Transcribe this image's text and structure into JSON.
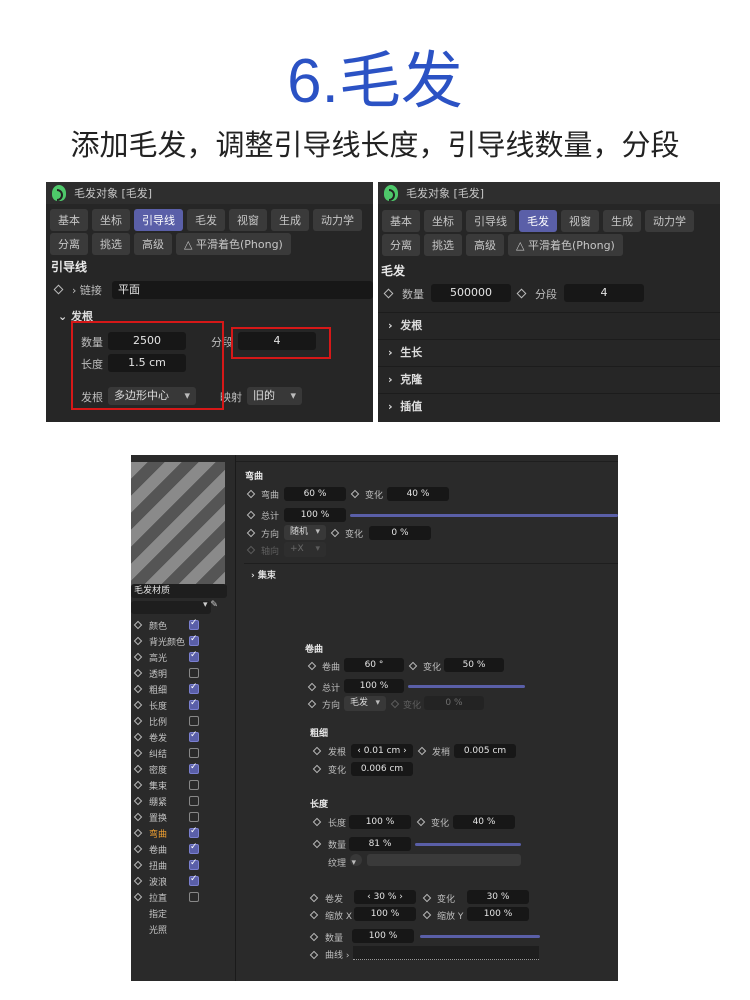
{
  "title": "6.毛发",
  "subtitle": "添加毛发，调整引导线长度，引导线数量，分段",
  "colors": {
    "title": "#2b52c4",
    "accent": "#5a5fa8",
    "highlight_box": "#d61818",
    "panel_bg": "#262626"
  },
  "panel_a": {
    "header": "毛发对象 [毛发]",
    "tabs_row1": [
      "基本",
      "坐标",
      "引导线",
      "毛发",
      "视窗",
      "生成",
      "动力学"
    ],
    "tabs_row2": [
      "分离",
      "挑选",
      "高级",
      "平滑着色(Phong)"
    ],
    "active_tab": "引导线",
    "section": "引导线",
    "link_label": "链接",
    "link_value": "平面",
    "group": "发根",
    "count_label": "数量",
    "count_value": "2500",
    "length_label": "长度",
    "length_value": "1.5 cm",
    "segments_label": "分段",
    "segments_value": "4",
    "root_label": "发根",
    "root_value": "多边形中心",
    "mapping_label": "映射",
    "mapping_value": "旧的"
  },
  "panel_b": {
    "header": "毛发对象 [毛发]",
    "tabs_row1": [
      "基本",
      "坐标",
      "引导线",
      "毛发",
      "视窗",
      "生成",
      "动力学"
    ],
    "tabs_row2": [
      "分离",
      "挑选",
      "高级",
      "平滑着色(Phong)"
    ],
    "active_tab": "毛发",
    "section": "毛发",
    "count_label": "数量",
    "count_value": "500000",
    "segments_label": "分段",
    "segments_value": "4",
    "groups": [
      "发根",
      "生长",
      "克隆",
      "插值"
    ]
  },
  "material": {
    "name": "毛发材质",
    "channels": [
      {
        "label": "颜色",
        "checked": true
      },
      {
        "label": "背光颜色",
        "checked": true
      },
      {
        "label": "高光",
        "checked": true
      },
      {
        "label": "透明",
        "checked": false
      },
      {
        "label": "粗细",
        "checked": true
      },
      {
        "label": "长度",
        "checked": true
      },
      {
        "label": "比例",
        "checked": false
      },
      {
        "label": "卷发",
        "checked": true
      },
      {
        "label": "纠结",
        "checked": false
      },
      {
        "label": "密度",
        "checked": true
      },
      {
        "label": "集束",
        "checked": false
      },
      {
        "label": "绷紧",
        "checked": false
      },
      {
        "label": "置换",
        "checked": false
      },
      {
        "label": "弯曲",
        "checked": true,
        "active": true
      },
      {
        "label": "卷曲",
        "checked": true
      },
      {
        "label": "扭曲",
        "checked": true
      },
      {
        "label": "波浪",
        "checked": true
      },
      {
        "label": "拉直",
        "checked": false
      }
    ],
    "extra": [
      "指定",
      "光照"
    ],
    "bend": {
      "title": "弯曲",
      "bend_label": "弯曲",
      "bend_value": "60 %",
      "var_label": "变化",
      "var_value": "40 %",
      "total_label": "总计",
      "total_value": "100 %",
      "total_fraction": 1.0,
      "dir_label": "方向",
      "dir_value": "随机",
      "var2_label": "变化",
      "var2_value": "0 %",
      "axis_label": "轴向",
      "axis_value": "+X",
      "cluster": "集束"
    },
    "curl": {
      "title": "卷曲",
      "curl_label": "卷曲",
      "curl_value": "60 °",
      "var_label": "变化",
      "var_value": "50 %",
      "total_label": "总计",
      "total_value": "100 %",
      "total_fraction": 1.0,
      "dir_label": "方向",
      "dir_value": "毛发",
      "var2_label": "变化",
      "var2_value": "0 %"
    },
    "thickness": {
      "title": "粗细",
      "root_label": "发根",
      "root_value": "0.01 cm",
      "tip_label": "发梢",
      "tip_value": "0.005 cm",
      "var_label": "变化",
      "var_value": "0.006 cm"
    },
    "length": {
      "title": "长度",
      "len_label": "长度",
      "len_value": "100 %",
      "var_label": "变化",
      "var_value": "40 %",
      "amount_label": "数量",
      "amount_value": "81 %",
      "amount_fraction": 0.81,
      "texture_label": "纹理"
    },
    "frizz": {
      "frizz_label": "卷发",
      "frizz_value": "30 %",
      "var_label": "变化",
      "var_value": "30 %",
      "sx_label": "缩放 X",
      "sx_value": "100 %",
      "sy_label": "缩放 Y",
      "sy_value": "100 %",
      "amount_label": "数量",
      "amount_value": "100 %",
      "amount_fraction": 1.0,
      "curve_label": "曲线"
    }
  }
}
